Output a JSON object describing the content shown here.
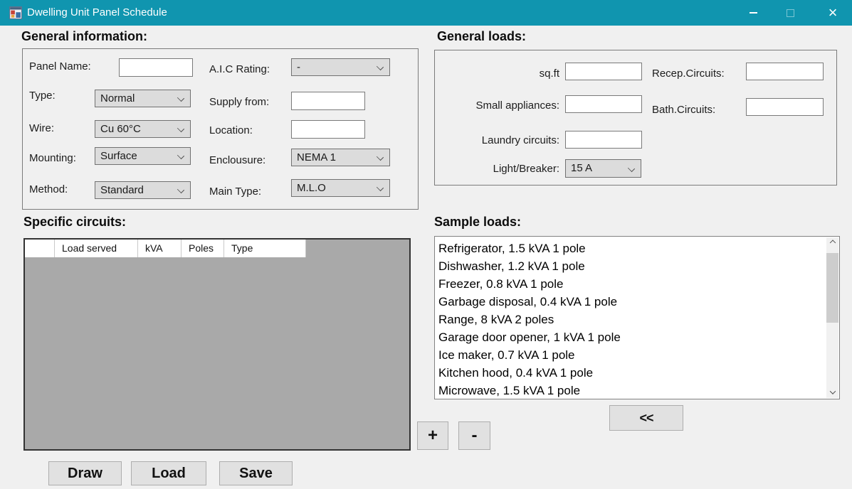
{
  "window": {
    "title": "Dwelling Unit Panel Schedule"
  },
  "icons": {
    "close": "×"
  },
  "colors": {
    "titlebar": "#1095af",
    "table_body": "#a9a9a9",
    "button_face": "#e1e1e1",
    "control_face": "#dcdcdc",
    "window_bg": "#f0f0f0"
  },
  "general_info": {
    "heading": "General information:",
    "panel_name_label": "Panel Name:",
    "aic_label": "A.I.C Rating:",
    "aic_value": "-",
    "type_label": "Type:",
    "type_value": "Normal",
    "supply_label": "Supply from:",
    "wire_label": "Wire:",
    "wire_value": "Cu 60°C",
    "location_label": "Location:",
    "mounting_label": "Mounting:",
    "mounting_value": "Surface",
    "enclosure_label": "Enclousure:",
    "enclosure_value": "NEMA 1",
    "method_label": "Method:",
    "method_value": "Standard",
    "main_type_label": "Main Type:",
    "main_type_value": "M.L.O"
  },
  "general_loads": {
    "heading": "General loads:",
    "sqft_label": "sq.ft",
    "recep_label": "Recep.Circuits:",
    "small_appliances_label": "Small appliances:",
    "bath_label": "Bath.Circuits:",
    "laundry_label": "Laundry circuits:",
    "light_breaker_label": "Light/Breaker:",
    "light_breaker_value": "15 A"
  },
  "specific_circuits": {
    "heading": "Specific circuits:",
    "columns": [
      "",
      "Load served",
      "kVA",
      "Poles",
      "Type"
    ]
  },
  "sample_loads": {
    "heading": "Sample loads:",
    "items": [
      "Refrigerator, 1.5 kVA 1 pole",
      "Dishwasher, 1.2 kVA 1 pole",
      "Freezer, 0.8 kVA 1 pole",
      "Garbage disposal, 0.4 kVA 1 pole",
      "Range, 8 kVA 2 poles",
      "Garage door opener, 1 kVA 1 pole",
      "Ice maker, 0.7 kVA 1 pole",
      "Kitchen hood, 0.4 kVA 1 pole",
      "Microwave, 1.5 kVA 1 pole"
    ]
  },
  "buttons": {
    "transfer": "<<",
    "add": "+",
    "remove": "-",
    "draw": "Draw",
    "load": "Load",
    "save": "Save"
  }
}
